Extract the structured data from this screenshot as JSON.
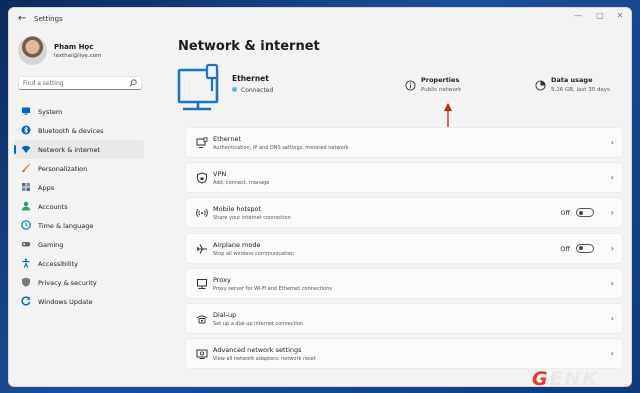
{
  "window": {
    "title": "Settings",
    "back_icon": "back-arrow-icon",
    "controls": [
      "minimize",
      "maximize",
      "close"
    ]
  },
  "profile": {
    "name": "Pham Học",
    "email": "lexthai@live.com"
  },
  "search": {
    "placeholder": "Find a setting"
  },
  "nav": {
    "items": [
      {
        "label": "System",
        "icon": "monitor-icon",
        "color": "#0067c0"
      },
      {
        "label": "Bluetooth & devices",
        "icon": "bluetooth-icon",
        "color": "#0067c0"
      },
      {
        "label": "Network & internet",
        "icon": "wifi-icon",
        "color": "#0067c0",
        "active": true
      },
      {
        "label": "Personalization",
        "icon": "brush-icon",
        "color": "#e07a2e"
      },
      {
        "label": "Apps",
        "icon": "apps-icon",
        "color": "#5b6b8a"
      },
      {
        "label": "Accounts",
        "icon": "person-icon",
        "color": "#2e9e5b"
      },
      {
        "label": "Time & language",
        "icon": "clock-globe-icon",
        "color": "#0a7cc4"
      },
      {
        "label": "Gaming",
        "icon": "gamepad-icon",
        "color": "#666"
      },
      {
        "label": "Accessibility",
        "icon": "accessibility-icon",
        "color": "#0067c0"
      },
      {
        "label": "Privacy & security",
        "icon": "shield-icon",
        "color": "#666"
      },
      {
        "label": "Windows Update",
        "icon": "update-icon",
        "color": "#0067c0"
      }
    ]
  },
  "main": {
    "title": "Network & internet",
    "ethernet": {
      "name": "Ethernet",
      "status": "Connected"
    },
    "properties": {
      "title": "Properties",
      "subtitle": "Public network"
    },
    "data_usage": {
      "title": "Data usage",
      "subtitle": "5.26 GB, last 30 days"
    },
    "cards": [
      {
        "title": "Ethernet",
        "subtitle": "Authentication, IP and DNS settings, metered network",
        "icon": "ethernet-icon"
      },
      {
        "title": "VPN",
        "subtitle": "Add, connect, manage",
        "icon": "vpn-shield-icon"
      },
      {
        "title": "Mobile hotspot",
        "subtitle": "Share your internet connection",
        "icon": "hotspot-icon",
        "toggle": "Off"
      },
      {
        "title": "Airplane mode",
        "subtitle": "Stop all wireless communication",
        "icon": "airplane-icon",
        "toggle": "Off"
      },
      {
        "title": "Proxy",
        "subtitle": "Proxy server for Wi-Fi and Ethernet connections",
        "icon": "proxy-icon"
      },
      {
        "title": "Dial-up",
        "subtitle": "Set up a dial-up internet connection",
        "icon": "dialup-icon"
      },
      {
        "title": "Advanced network settings",
        "subtitle": "View all network adapters, network reset",
        "icon": "advanced-network-icon"
      }
    ]
  },
  "watermark": {
    "brand": "GENK",
    "accent": "#e23b2c"
  }
}
